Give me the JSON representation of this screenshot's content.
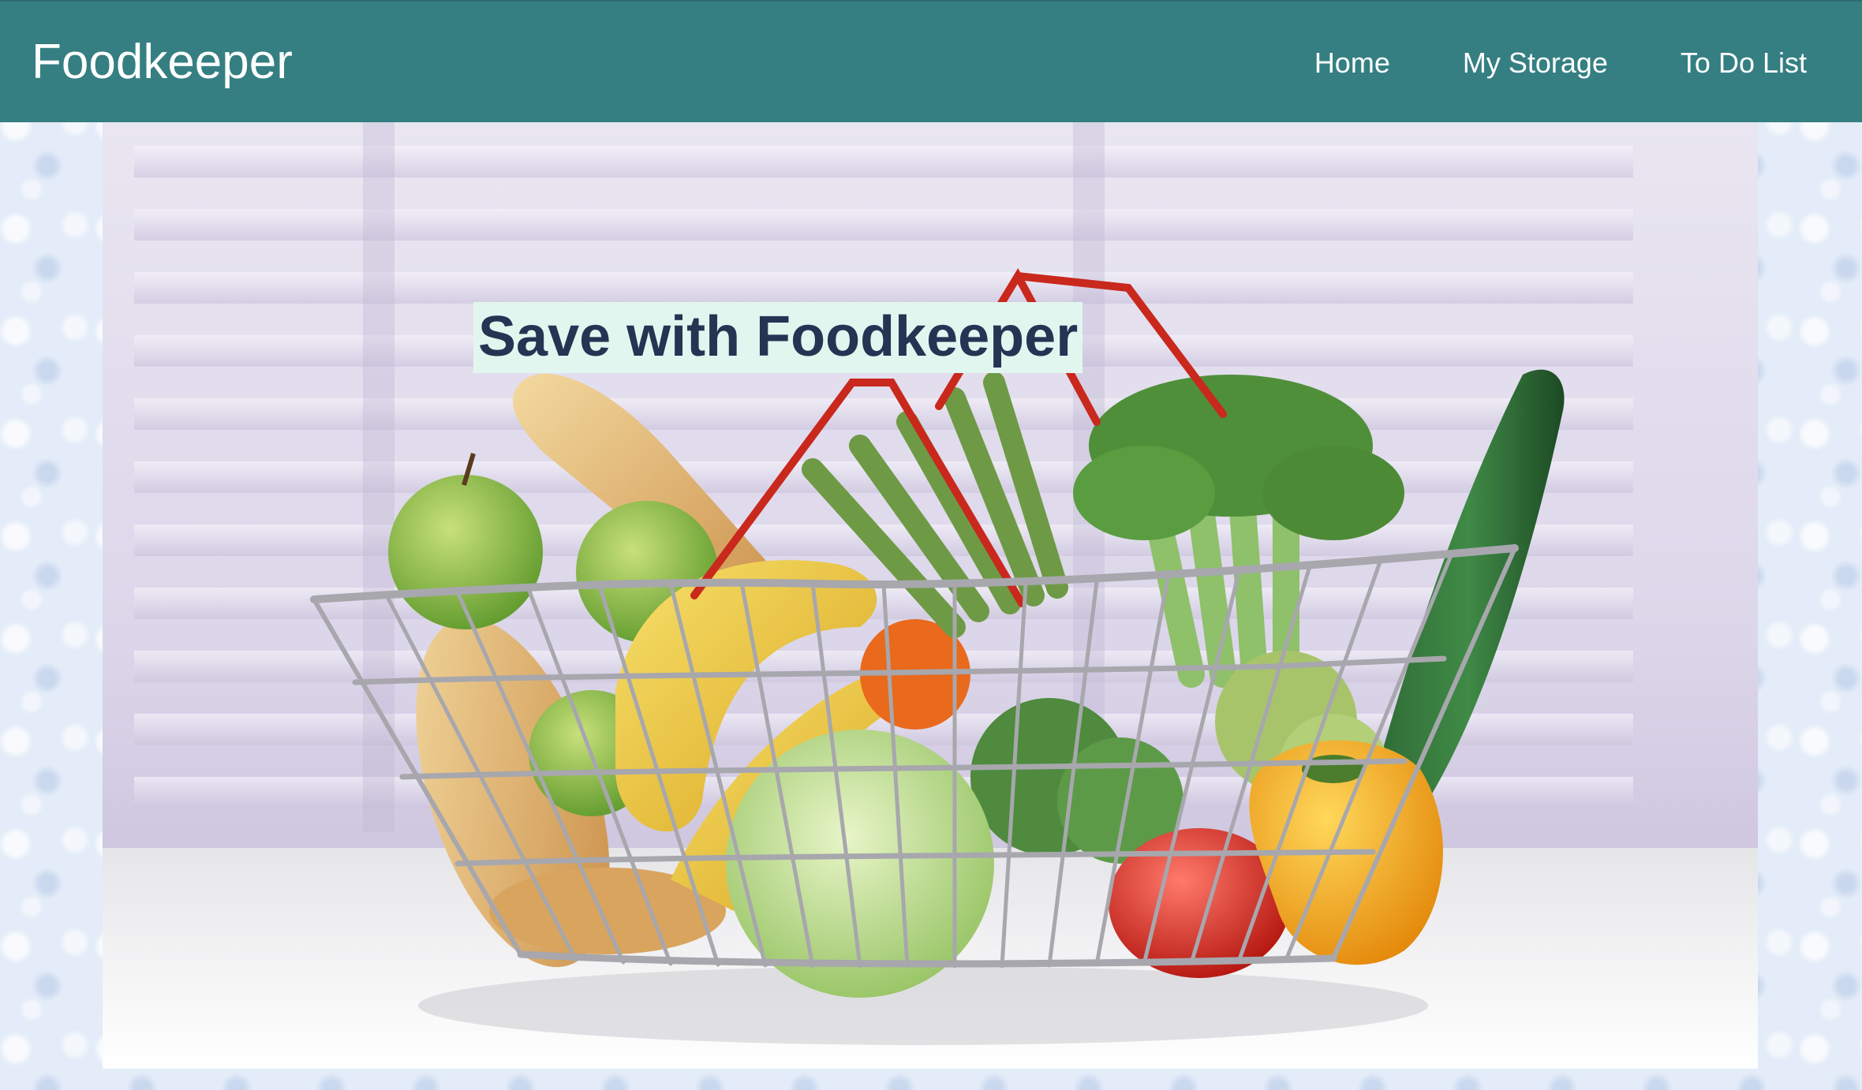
{
  "app": {
    "brand": "Foodkeeper"
  },
  "nav": {
    "items": [
      {
        "label": "Home"
      },
      {
        "label": "My Storage"
      },
      {
        "label": "To Do List"
      }
    ]
  },
  "hero": {
    "title": "Save with Foodkeeper",
    "image_icon": "grocery-basket-image"
  },
  "colors": {
    "header_bg": "#357f82",
    "header_text": "#ffffff",
    "title_text": "#233553",
    "title_bg": "#e2f6f0"
  }
}
